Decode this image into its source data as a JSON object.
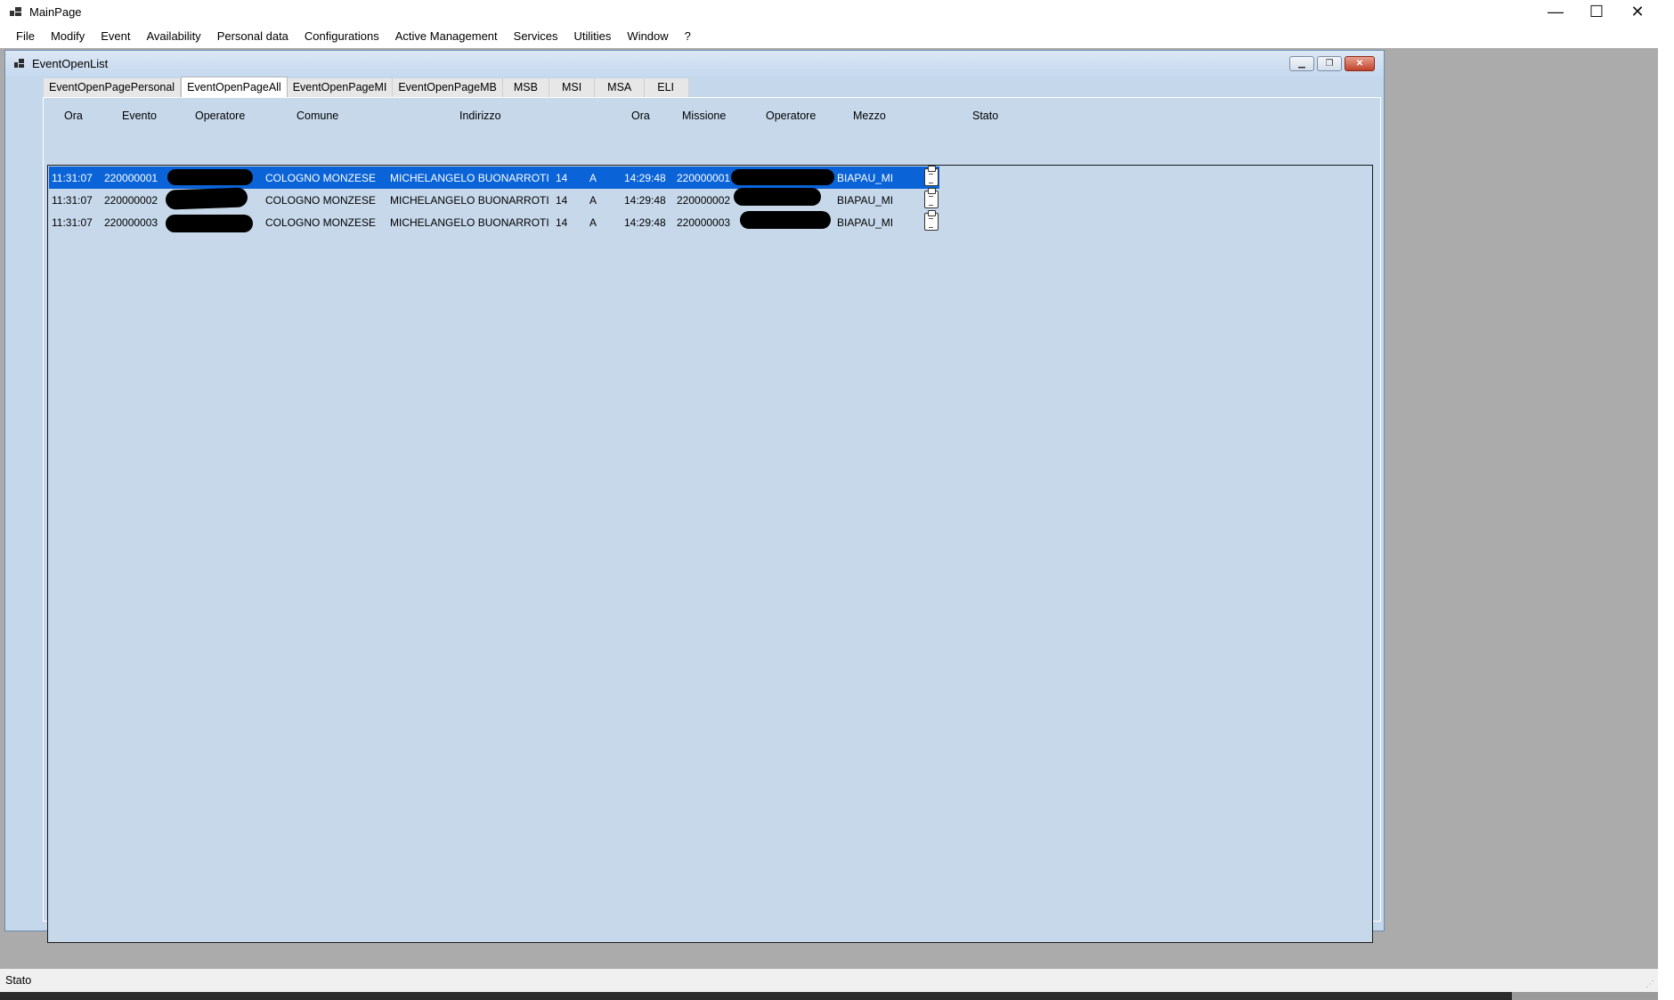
{
  "window": {
    "title": "MainPage",
    "minimize": "—",
    "maximize": "☐",
    "close": "✕"
  },
  "menu": [
    "File",
    "Modify",
    "Event",
    "Availability",
    "Personal data",
    "Configurations",
    "Active Management",
    "Services",
    "Utilities",
    "Window",
    "?"
  ],
  "child": {
    "title": "EventOpenList",
    "minimize": "▁",
    "restore": "❐",
    "close": "✕"
  },
  "tabs": [
    {
      "label": "EventOpenPagePersonal",
      "active": false
    },
    {
      "label": "EventOpenPageAll",
      "active": true
    },
    {
      "label": "EventOpenPageMI",
      "active": false
    },
    {
      "label": "EventOpenPageMB",
      "active": false
    },
    {
      "label": "MSB",
      "active": false
    },
    {
      "label": "MSI",
      "active": false
    },
    {
      "label": "MSA",
      "active": false
    },
    {
      "label": "ELI",
      "active": false
    }
  ],
  "columns": [
    "Ora",
    "Evento",
    "Operatore",
    "Comune",
    "Indirizzo",
    "Ora",
    "Missione",
    "Operatore",
    "Mezzo",
    "Stato"
  ],
  "rows": [
    {
      "ora": "11:31:07",
      "evento": "220000001",
      "operatore": "",
      "comune": "COLOGNO MONZESE",
      "indirizzo": "MICHELANGELO BUONARROTI",
      "civico": "14",
      "lettera": "A",
      "ora2": "14:29:48",
      "missione": "220000001",
      "operatore2": "",
      "mezzo": "BIAPAU_MI",
      "selected": true
    },
    {
      "ora": "11:31:07",
      "evento": "220000002",
      "operatore": "",
      "comune": "COLOGNO MONZESE",
      "indirizzo": "MICHELANGELO BUONARROTI",
      "civico": "14",
      "lettera": "A",
      "ora2": "14:29:48",
      "missione": "220000002",
      "operatore2": "",
      "mezzo": "BIAPAU_MI",
      "selected": false
    },
    {
      "ora": "11:31:07",
      "evento": "220000003",
      "operatore": "",
      "comune": "COLOGNO MONZESE",
      "indirizzo": "MICHELANGELO BUONARROTI",
      "civico": "14",
      "lettera": "A",
      "ora2": "14:29:48",
      "missione": "220000003",
      "operatore2": "",
      "mezzo": "BIAPAU_MI",
      "selected": false
    }
  ],
  "status": {
    "text": "Stato"
  },
  "colors": {
    "selection": "#0a64d8",
    "panel": "#c6d8ea",
    "mdi_background": "#ababab"
  }
}
